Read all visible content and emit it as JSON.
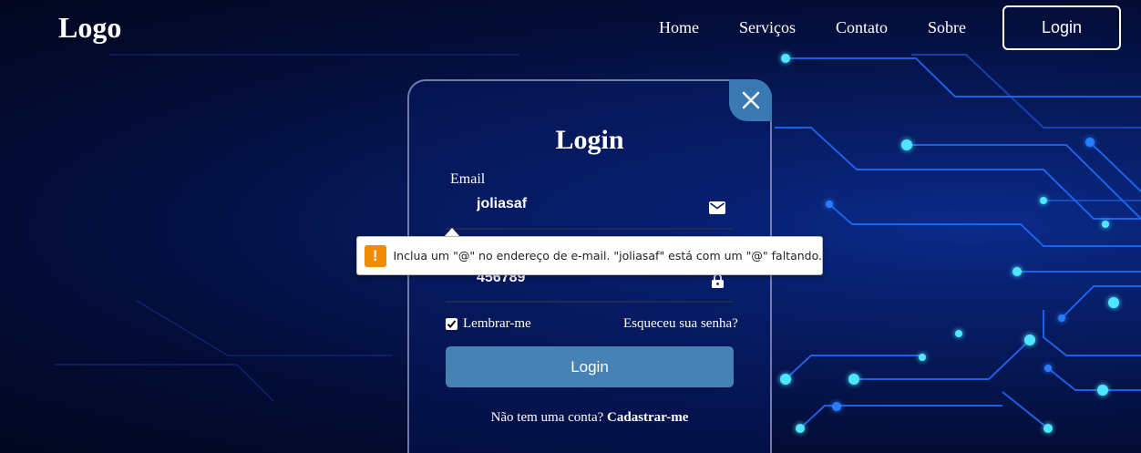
{
  "header": {
    "logo": "Logo",
    "nav": [
      "Home",
      "Serviços",
      "Contato",
      "Sobre"
    ],
    "login_button": "Login"
  },
  "modal": {
    "title": "Login",
    "email_label": "Email",
    "email_value": "joliasaf",
    "password_value": "456789",
    "remember_label": "Lembrar-me",
    "remember_checked": true,
    "forgot_link": "Esqueceu sua senha?",
    "submit_label": "Login",
    "register_prompt": "Não tem uma conta?",
    "register_link": "Cadastrar-me"
  },
  "validation": {
    "icon": "!",
    "message": "Inclua um \"@\" no endereço de e-mail. \"joliasaf\" está com um \"@\" faltando."
  },
  "theme": {
    "accent": "#4682b4",
    "close_bg": "#3b79b3",
    "warning": "#f08c00",
    "background": "#030c35",
    "circuit": "#1e6fff"
  }
}
